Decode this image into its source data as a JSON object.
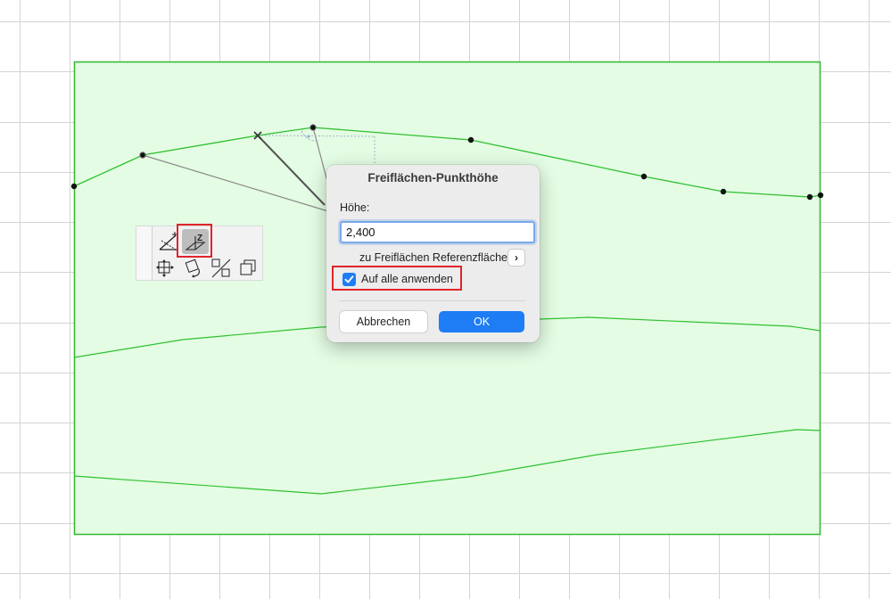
{
  "canvas": {
    "grid_color": "#d4d4d4",
    "fill_color": "#e3fce3",
    "line_color": "#2fc02f"
  },
  "pet_palette": {
    "tools": [
      {
        "name": "slope-icon"
      },
      {
        "name": "elevation-z-icon",
        "active": true
      },
      {
        "name": "move-icon"
      },
      {
        "name": "rotate-icon"
      },
      {
        "name": "split-icon"
      },
      {
        "name": "copy-icon"
      }
    ]
  },
  "dialog": {
    "title": "Freiflächen-Punkthöhe",
    "height_label": "Höhe:",
    "height_value": "2,400",
    "reference_label": "zu Freiflächen Referenzfläche",
    "reference_button": "›",
    "apply_all_label": "Auf alle anwenden",
    "apply_all_checked": true,
    "cancel_label": "Abbrechen",
    "ok_label": "OK",
    "accent_color": "#1e7cf5"
  }
}
